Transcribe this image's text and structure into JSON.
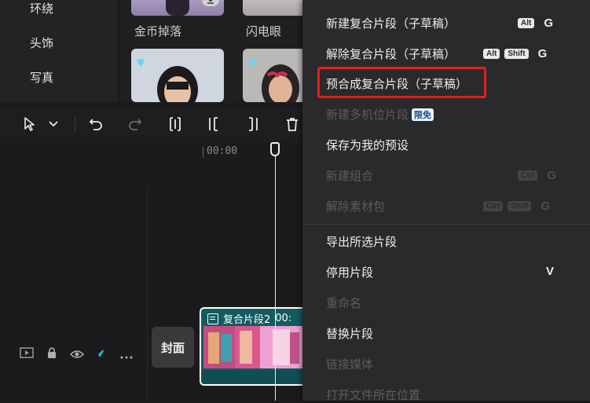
{
  "categories": [
    "环绕",
    "头饰",
    "写真"
  ],
  "effects": {
    "tiles": [
      {
        "label": "金币掉落"
      },
      {
        "label": "闪电眼"
      }
    ]
  },
  "toolbar": {
    "icons": [
      "select-cursor-icon",
      "chevron-down-icon",
      "undo-icon",
      "redo-icon",
      "split-icon",
      "trim-left-icon",
      "trim-right-icon",
      "delete-icon"
    ]
  },
  "timeline": {
    "ruler_time": "00:00",
    "cover_label": "封面",
    "clip_title": "复合片段2",
    "clip_time": "00:"
  },
  "context_menu": {
    "items": [
      {
        "label": "新建复合片段（子草稿）",
        "enabled": true,
        "keys": [
          "Alt"
        ],
        "letter": "G"
      },
      {
        "label": "解除复合片段（子草稿）",
        "enabled": true,
        "keys": [
          "Alt",
          "Shift"
        ],
        "letter": "G"
      },
      {
        "label": "预合成复合片段（子草稿）",
        "enabled": true,
        "highlighted": true
      },
      {
        "label": "新建多机位片段",
        "enabled": false,
        "badge": "限免"
      },
      {
        "label": "保存为我的预设",
        "enabled": true
      },
      {
        "label": "新建组合",
        "enabled": false,
        "keys": [
          "Ctrl"
        ],
        "letter": "G"
      },
      {
        "label": "解除素材包",
        "enabled": false,
        "keys": [
          "Ctrl",
          "Shift"
        ],
        "letter": "G"
      },
      {
        "label": "导出所选片段",
        "enabled": true
      },
      {
        "label": "停用片段",
        "enabled": true,
        "letter": "V"
      },
      {
        "label": "重命名",
        "enabled": false
      },
      {
        "label": "替换片段",
        "enabled": true
      },
      {
        "label": "链接媒体",
        "enabled": false
      },
      {
        "label": "打开文件所在位置",
        "enabled": false
      }
    ]
  },
  "colors": {
    "accent_highlight": "#e02020",
    "clip_bg": "#125b5f",
    "badge_bg": "#e8f4ff"
  }
}
